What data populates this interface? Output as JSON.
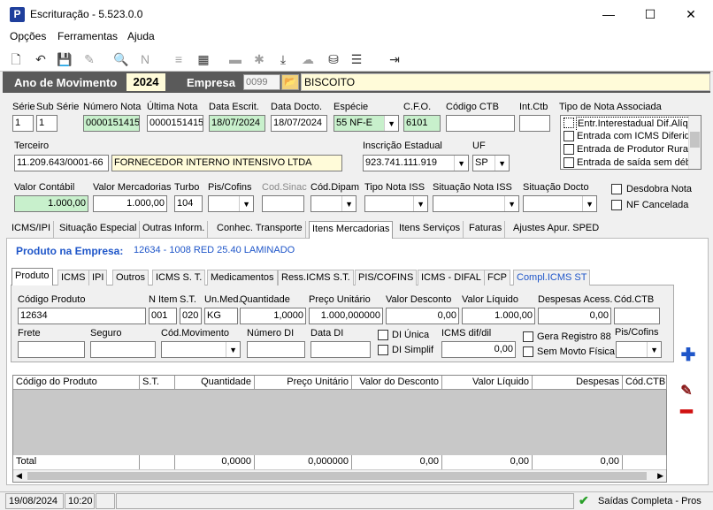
{
  "window": {
    "title": "Escrituração - 5.523.0.0",
    "minimize": "—",
    "maximize": "☐",
    "close": "✕"
  },
  "menu": [
    "Opções",
    "Ferramentas",
    "Ajuda"
  ],
  "toolbar": {
    "icons": [
      "new-document-icon",
      "undo-icon",
      "save-icon",
      "eraser-icon",
      "print-preview-icon",
      "nfe-icon",
      "tree-icon",
      "calculator-icon",
      "folder-icon",
      "puzzle-icon",
      "download-icon",
      "cloud-icon",
      "cb-icon",
      "list-icon",
      "exit-icon"
    ]
  },
  "header": {
    "ano_label": "Ano de Movimento",
    "ano_value": "2024",
    "empresa_label": "Empresa",
    "empresa_code": "0099",
    "empresa_name": "BISCOITO"
  },
  "nota": {
    "serie_label": "Série",
    "serie": "1",
    "subserie_label": "Sub Série",
    "subserie": "1",
    "numero_label": "Número Nota",
    "numero": "0000151415",
    "ultima_label": "Última Nota",
    "ultima": "0000151415",
    "data_escrit_label": "Data Escrit.",
    "data_escrit": "18/07/2024",
    "data_docto_label": "Data Docto.",
    "data_docto": "18/07/2024",
    "especie_label": "Espécie",
    "especie": "55  NF-E",
    "cfo_label": "C.F.O.",
    "cfo": "6101",
    "codigo_ctb_label": "Código CTB",
    "codigo_ctb": "",
    "int_ctb_label": "Int.Ctb",
    "int_ctb": "",
    "tipo_nota_label": "Tipo de Nota Associada",
    "tipo_nota_options": [
      "Entr.Interestadual Dif.Alíq",
      "Entrada com ICMS Diferido",
      "Entrada de Produtor Rural",
      "Entrada de saída sem débi"
    ],
    "terceiro_label": "Terceiro",
    "terceiro_cnpj": "11.209.643/0001-66",
    "terceiro_nome": "FORNECEDOR INTERNO INTENSIVO LTDA",
    "ie_label": "Inscrição Estadual",
    "ie": "923.741.111.919",
    "uf_label": "UF",
    "uf": "SP",
    "valor_contabil_label": "Valor Contábil",
    "valor_contabil": "1.000,00",
    "valor_merc_label": "Valor Mercadorias",
    "valor_merc": "1.000,00",
    "turbo_label": "Turbo",
    "turbo": "104",
    "pis_cofins_label": "Pis/Cofins",
    "cod_sinac_label": "Cod.Sinac",
    "cod_dipam_label": "Cód.Dipam",
    "tipo_iss_label": "Tipo Nota ISS",
    "sit_iss_label": "Situação Nota ISS",
    "sit_docto_label": "Situação Docto",
    "desdobra_label": "Desdobra Nota",
    "cancelada_label": "NF Cancelada"
  },
  "tabs": [
    "ICMS/IPI",
    "Situação Especial",
    "Outras Inform.",
    "Conhec. Transporte",
    "Itens Mercadorias",
    "Itens Serviços",
    "Faturas",
    "Ajustes Apur. SPED"
  ],
  "produto_empresa": {
    "label": "Produto na Empresa:",
    "value": "12634 - 1008 RED 25.40 LAMINADO"
  },
  "subtabs": [
    "Produto",
    "ICMS",
    "IPI",
    "Outros",
    "ICMS S. T.",
    "Medicamentos",
    "Ress.ICMS S.T.",
    "PIS/COFINS",
    "ICMS - DIFAL",
    "FCP",
    "Compl.ICMS ST"
  ],
  "produto": {
    "codigo_label": "Código Produto",
    "codigo": "12634",
    "n_item_label": "N Item",
    "n_item": "001",
    "st_label": "S.T.",
    "st": "020",
    "un_label": "Un.Med.",
    "un": "KG",
    "qtd_label": "Quantidade",
    "qtd": "1,0000",
    "preco_label": "Preço Unitário",
    "preco": "1.000,000000",
    "desconto_label": "Valor Desconto",
    "desconto": "0,00",
    "liquido_label": "Valor Líquido",
    "liquido": "1.000,00",
    "despesas_label": "Despesas Acess.",
    "despesas": "0,00",
    "cod_ctb_label": "Cód.CTB",
    "cod_ctb": "",
    "frete_label": "Frete",
    "seguro_label": "Seguro",
    "cod_mov_label": "Cód.Movimento",
    "numero_di_label": "Número DI",
    "data_di_label": "Data DI",
    "di_unica_label": "DI Única",
    "di_simplif_label": "DI Simplif",
    "icms_difdil_label": "ICMS dif/dil",
    "icms_difdil": "0,00",
    "gera_registro_label": "Gera Registro 88",
    "sem_movto_label": "Sem Movto Física",
    "pis_cofins_label": "Pis/Cofins"
  },
  "grid": {
    "columns": [
      "Código do Produto",
      "S.T.",
      "Quantidade",
      "Preço Unitário",
      "Valor do Desconto",
      "Valor Líquido",
      "Despesas",
      "Cód.CTB"
    ],
    "total_label": "Total",
    "totals": [
      "",
      "",
      "0,0000",
      "0,000000",
      "0,00",
      "0,00",
      "0,00",
      ""
    ]
  },
  "status": {
    "date": "19/08/2024",
    "time": "10:20",
    "message": "Saídas Completa - Pros"
  },
  "colors": {
    "accent": "#1f56c9",
    "header_dark": "#5a5a5a",
    "highlight_yellow": "#fffbd9",
    "field_green": "#c8f0cc"
  }
}
